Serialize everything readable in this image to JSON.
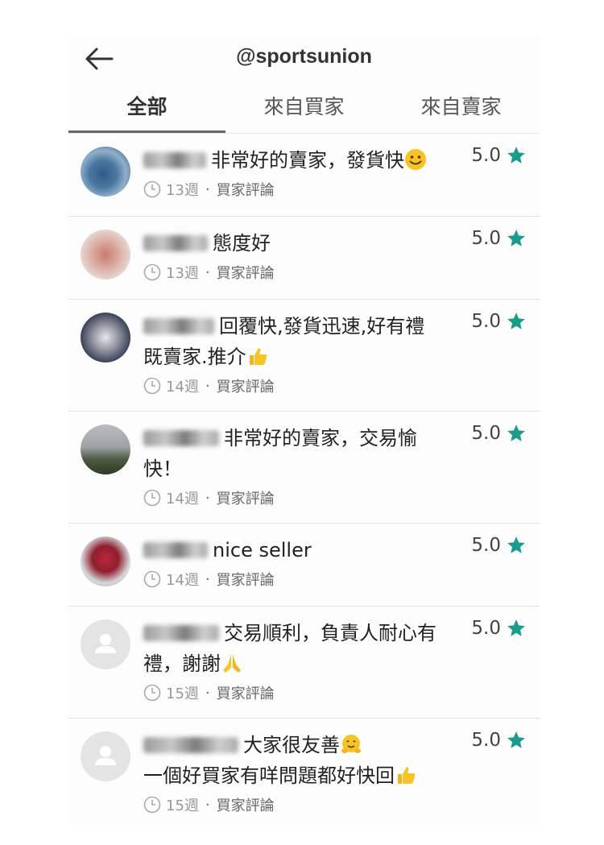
{
  "header": {
    "title": "@sportsunion"
  },
  "tabs": [
    {
      "label": "全部",
      "active": true
    },
    {
      "label": "來自買家",
      "active": false
    },
    {
      "label": "來自賣家",
      "active": false
    }
  ],
  "colors": {
    "star": "#1a9c8c",
    "tab_indicator": "#666666"
  },
  "reviews": [
    {
      "lines": [
        "非常好的賣家，發貨快"
      ],
      "emoji": "smile-emoji",
      "rating": "5.0",
      "weeks": "13週",
      "type": "買家評論"
    },
    {
      "lines": [
        "態度好"
      ],
      "emoji": "",
      "rating": "5.0",
      "weeks": "13週",
      "type": "買家評論"
    },
    {
      "lines": [
        "回覆快,發貨迅速,好有禮",
        "既賣家.推介"
      ],
      "emoji": "thumbs-up-emoji",
      "rating": "5.0",
      "weeks": "14週",
      "type": "買家評論"
    },
    {
      "lines": [
        "非常好的賣家，交易愉",
        "快！"
      ],
      "emoji": "",
      "rating": "5.0",
      "weeks": "14週",
      "type": "買家評論"
    },
    {
      "lines": [
        "nice seller"
      ],
      "emoji": "",
      "rating": "5.0",
      "weeks": "14週",
      "type": "買家評論"
    },
    {
      "lines": [
        "交易順利，負責人耐心有",
        "禮，謝謝"
      ],
      "emoji": "pray-emoji",
      "rating": "5.0",
      "weeks": "15週",
      "type": "買家評論"
    },
    {
      "lines": [
        "大家很友善",
        "一個好買家有咩問題都好快回"
      ],
      "emoji": "hug-emoji,thumbs-up-emoji",
      "rating": "5.0",
      "weeks": "15週",
      "type": "買家評論"
    }
  ]
}
